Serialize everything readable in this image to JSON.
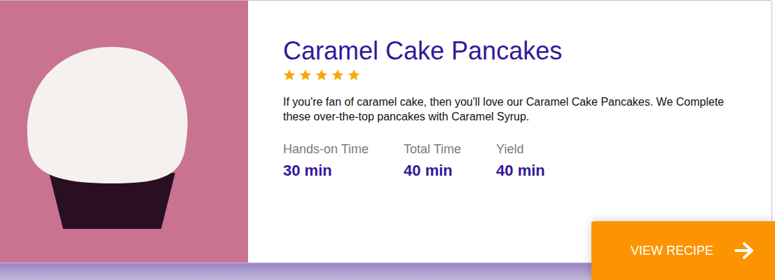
{
  "recipe": {
    "title": "Caramel Cake Pancakes",
    "stars": 5,
    "description": "If you're fan of caramel cake, then you'll love our Caramel Cake Pancakes. We Complete these over-the-top pancakes with Caramel Syrup.",
    "stats": [
      {
        "label": "Hands-on Time",
        "value": "30 min"
      },
      {
        "label": "Total Time",
        "value": "40 min"
      },
      {
        "label": "Yield",
        "value": "40 min"
      }
    ],
    "button": "VIEW RECIPE"
  }
}
